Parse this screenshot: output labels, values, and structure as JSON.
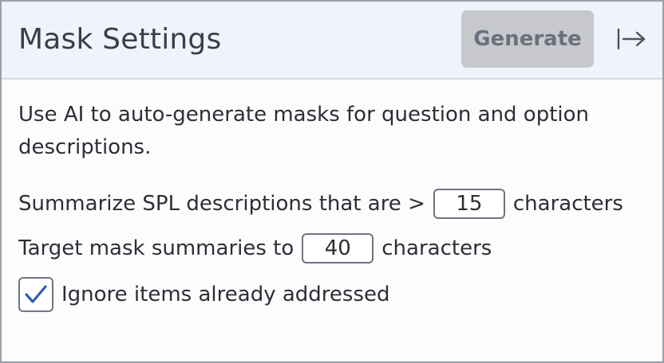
{
  "header": {
    "title": "Mask Settings",
    "generate_label": "Generate",
    "collapse_icon": "collapse-right-icon"
  },
  "intro": {
    "description": "Use AI to auto-generate masks for question and option descriptions."
  },
  "settings": {
    "summarize_prefix": "Summarize SPL descriptions that are >",
    "summarize_threshold": "15",
    "summarize_suffix": "characters",
    "target_prefix": "Target mask summaries to",
    "target_length": "40",
    "target_suffix": "characters",
    "ignore_label": "Ignore items already addressed",
    "ignore_checked": true
  },
  "colors": {
    "header_bg": "#eff4fc",
    "button_disabled_bg": "#c7c8cc",
    "check_color": "#2f5fb3"
  }
}
